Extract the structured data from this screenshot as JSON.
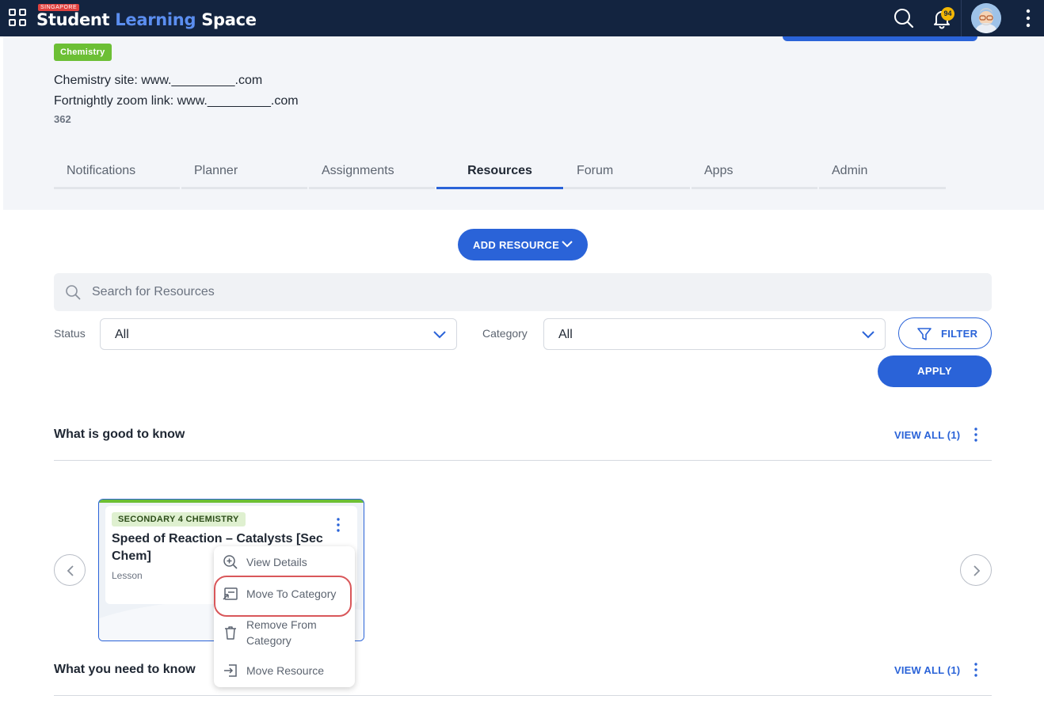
{
  "topbar": {
    "brand_tag": "SINGAPORE",
    "brand_part1": "Student",
    "brand_part2": "Learning",
    "brand_part3": "Space",
    "notification_count": "94",
    "icons": [
      "apps-grid-icon",
      "search-icon",
      "bell-icon",
      "avatar",
      "more-vertical-icon"
    ]
  },
  "header": {
    "subject_badge": "Chemistry",
    "line1": "Chemistry site: www._________.com",
    "line2": "Fortnightly zoom link: www._________.com",
    "count": "362"
  },
  "tabs": [
    {
      "label": "Notifications"
    },
    {
      "label": "Planner"
    },
    {
      "label": "Assignments"
    },
    {
      "label": "Resources",
      "active": true
    },
    {
      "label": "Forum"
    },
    {
      "label": "Apps"
    },
    {
      "label": "Admin"
    }
  ],
  "controls": {
    "add_resource": "ADD RESOURCE",
    "search_placeholder": "Search for Resources",
    "status_label": "Status",
    "status_value": "All",
    "category_label": "Category",
    "category_value": "All",
    "filter": "FILTER",
    "apply": "APPLY"
  },
  "sections": [
    {
      "title": "What is good to know",
      "view_all": "VIEW ALL (1)"
    },
    {
      "title": "What you need to know",
      "view_all": "VIEW ALL (1)"
    }
  ],
  "card": {
    "level": "SECONDARY 4 CHEMISTRY",
    "title": "Speed of Reaction – Catalysts [Sec Chem]",
    "type": "Lesson"
  },
  "menu": [
    {
      "label": "View Details",
      "icon": "zoom-in-icon"
    },
    {
      "label": "Move To Category",
      "icon": "move-category-icon",
      "highlighted": true
    },
    {
      "label": "Remove From Category",
      "icon": "trash-icon"
    },
    {
      "label": "Move Resource",
      "icon": "move-resource-icon"
    }
  ],
  "colors": {
    "topbar": "#132440",
    "accent": "#2a63d8",
    "subject": "#6cbf35",
    "highlight": "#d9575a"
  }
}
